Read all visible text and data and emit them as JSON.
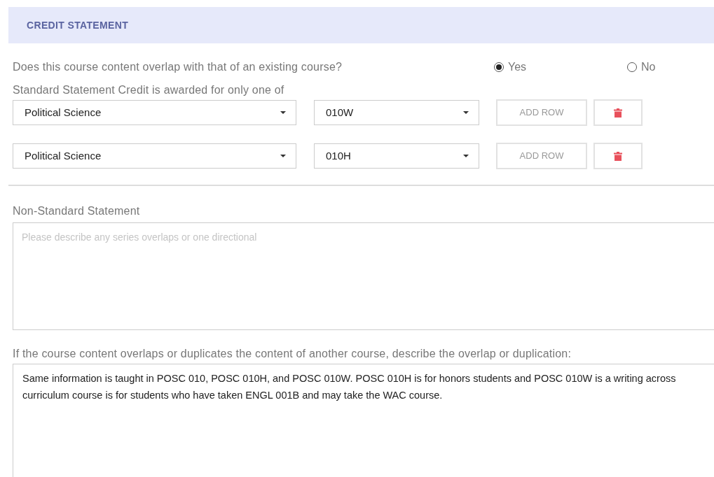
{
  "section": {
    "title": "CREDIT STATEMENT"
  },
  "overlap_question": {
    "label": "Does this course content overlap with that of an existing course?",
    "options": [
      {
        "label": "Yes",
        "selected": true
      },
      {
        "label": "No",
        "selected": false
      }
    ]
  },
  "standard_statement": {
    "label": "Standard Statement Credit is awarded for only one of",
    "rows": [
      {
        "subject": "Political Science",
        "course": "010W",
        "add_button": "ADD ROW"
      },
      {
        "subject": "Political Science",
        "course": "010H",
        "add_button": "ADD ROW"
      }
    ]
  },
  "non_standard_statement": {
    "label": "Non-Standard Statement",
    "placeholder": "Please describe any series overlaps or one directional"
  },
  "duplication": {
    "label": "If the course content overlaps or duplicates the content of another course, describe the overlap or duplication:",
    "value": "Same information is taught in POSC 010, POSC 010H, and POSC 010W. POSC 010H is for honors students and POSC 010W is a writing across curriculum course is for students who have taken ENGL 001B and may take the WAC course."
  }
}
